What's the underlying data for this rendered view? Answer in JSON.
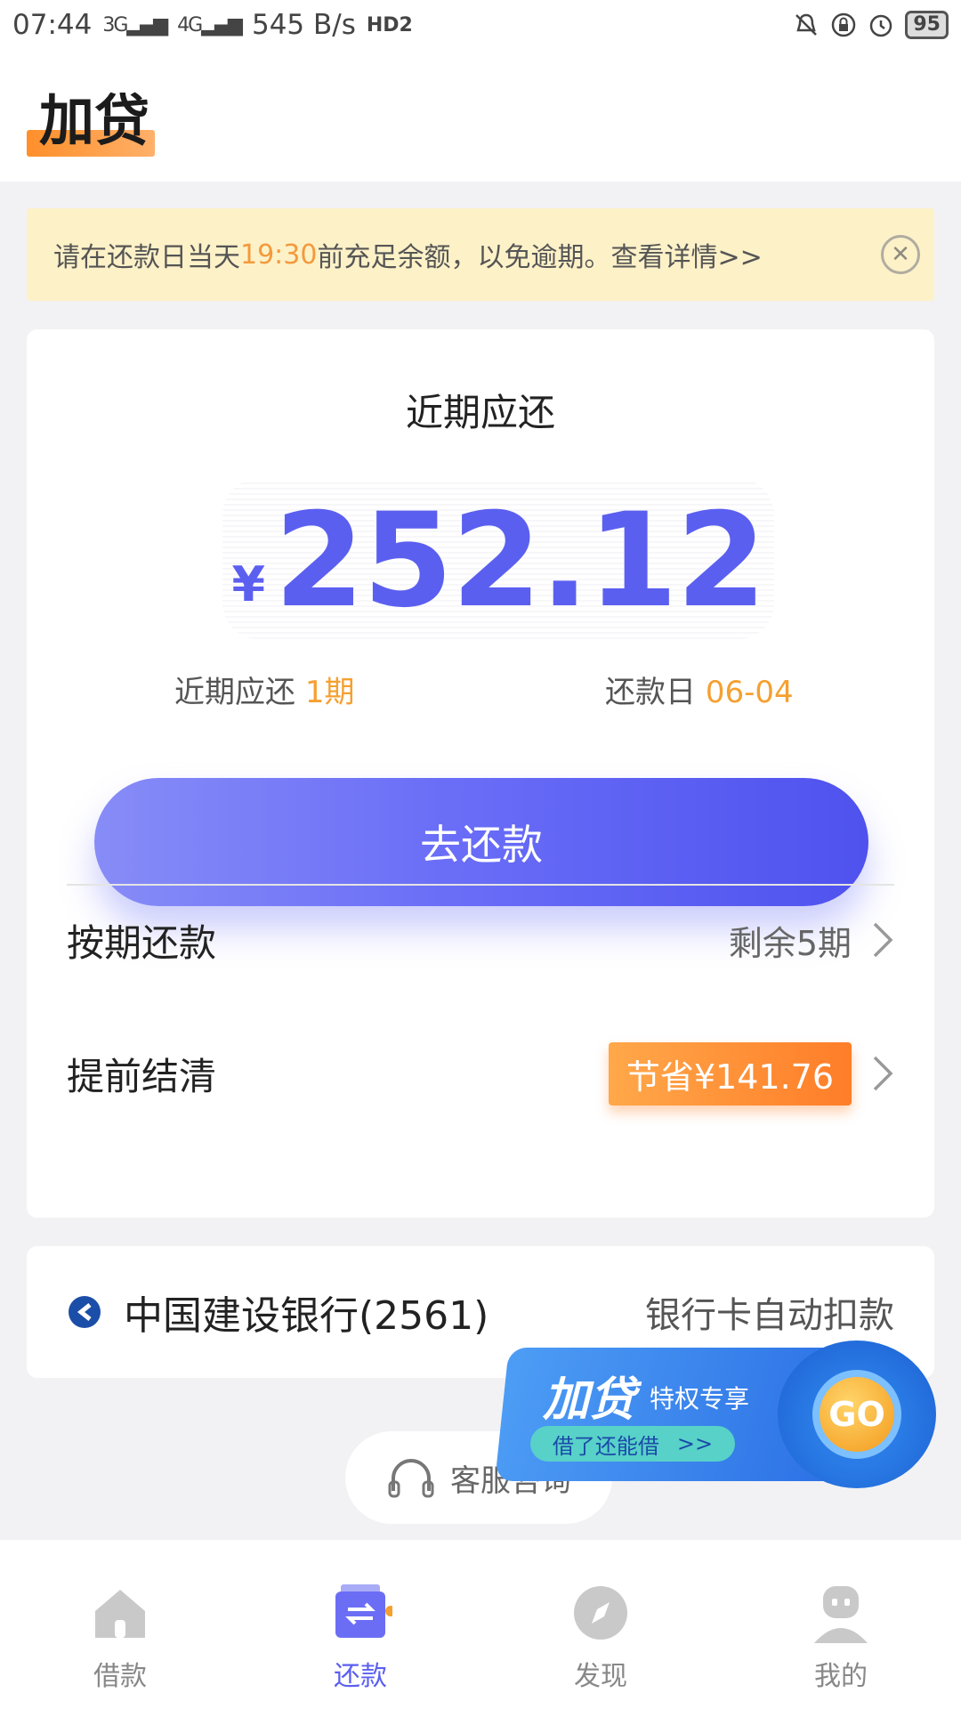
{
  "status_bar": {
    "time": "07:44",
    "network_3g": "3G",
    "network_4g": "4G",
    "speed": "545 B/s",
    "hd": "HD2",
    "battery": "95"
  },
  "header": {
    "title": "加贷"
  },
  "notice": {
    "text_before": "请在还款日当天",
    "time": "19:30",
    "text_after": "前充足余额，以免逾期。查看详情>>",
    "close_icon": "close-icon"
  },
  "repayment": {
    "title": "近期应还",
    "currency": "¥",
    "amount": "252.12",
    "periods_label": "近期应还",
    "periods_value": "1期",
    "due_label": "还款日",
    "due_value": "06-04",
    "button": "去还款"
  },
  "options": {
    "installment_label": "按期还款",
    "installment_remaining": "剩余5期",
    "early_label": "提前结清",
    "early_saving": "节省¥141.76"
  },
  "bank": {
    "name": "中国建设银行(2561)",
    "method": "银行卡自动扣款"
  },
  "customer_service": {
    "label": "客服咨询"
  },
  "promo": {
    "title": "加贷",
    "subtitle": "特权专享",
    "pill": "借了还能借",
    "pill_arrow": ">>",
    "go": "GO"
  },
  "nav": {
    "items": [
      {
        "label": "借款",
        "icon": "home-icon"
      },
      {
        "label": "还款",
        "icon": "repay-icon"
      },
      {
        "label": "发现",
        "icon": "compass-icon"
      },
      {
        "label": "我的",
        "icon": "profile-icon"
      }
    ],
    "active_index": 1
  },
  "colors": {
    "accent": "#5b5ff0",
    "orange": "#f5a030",
    "notice_bg": "#fdf1c8"
  }
}
